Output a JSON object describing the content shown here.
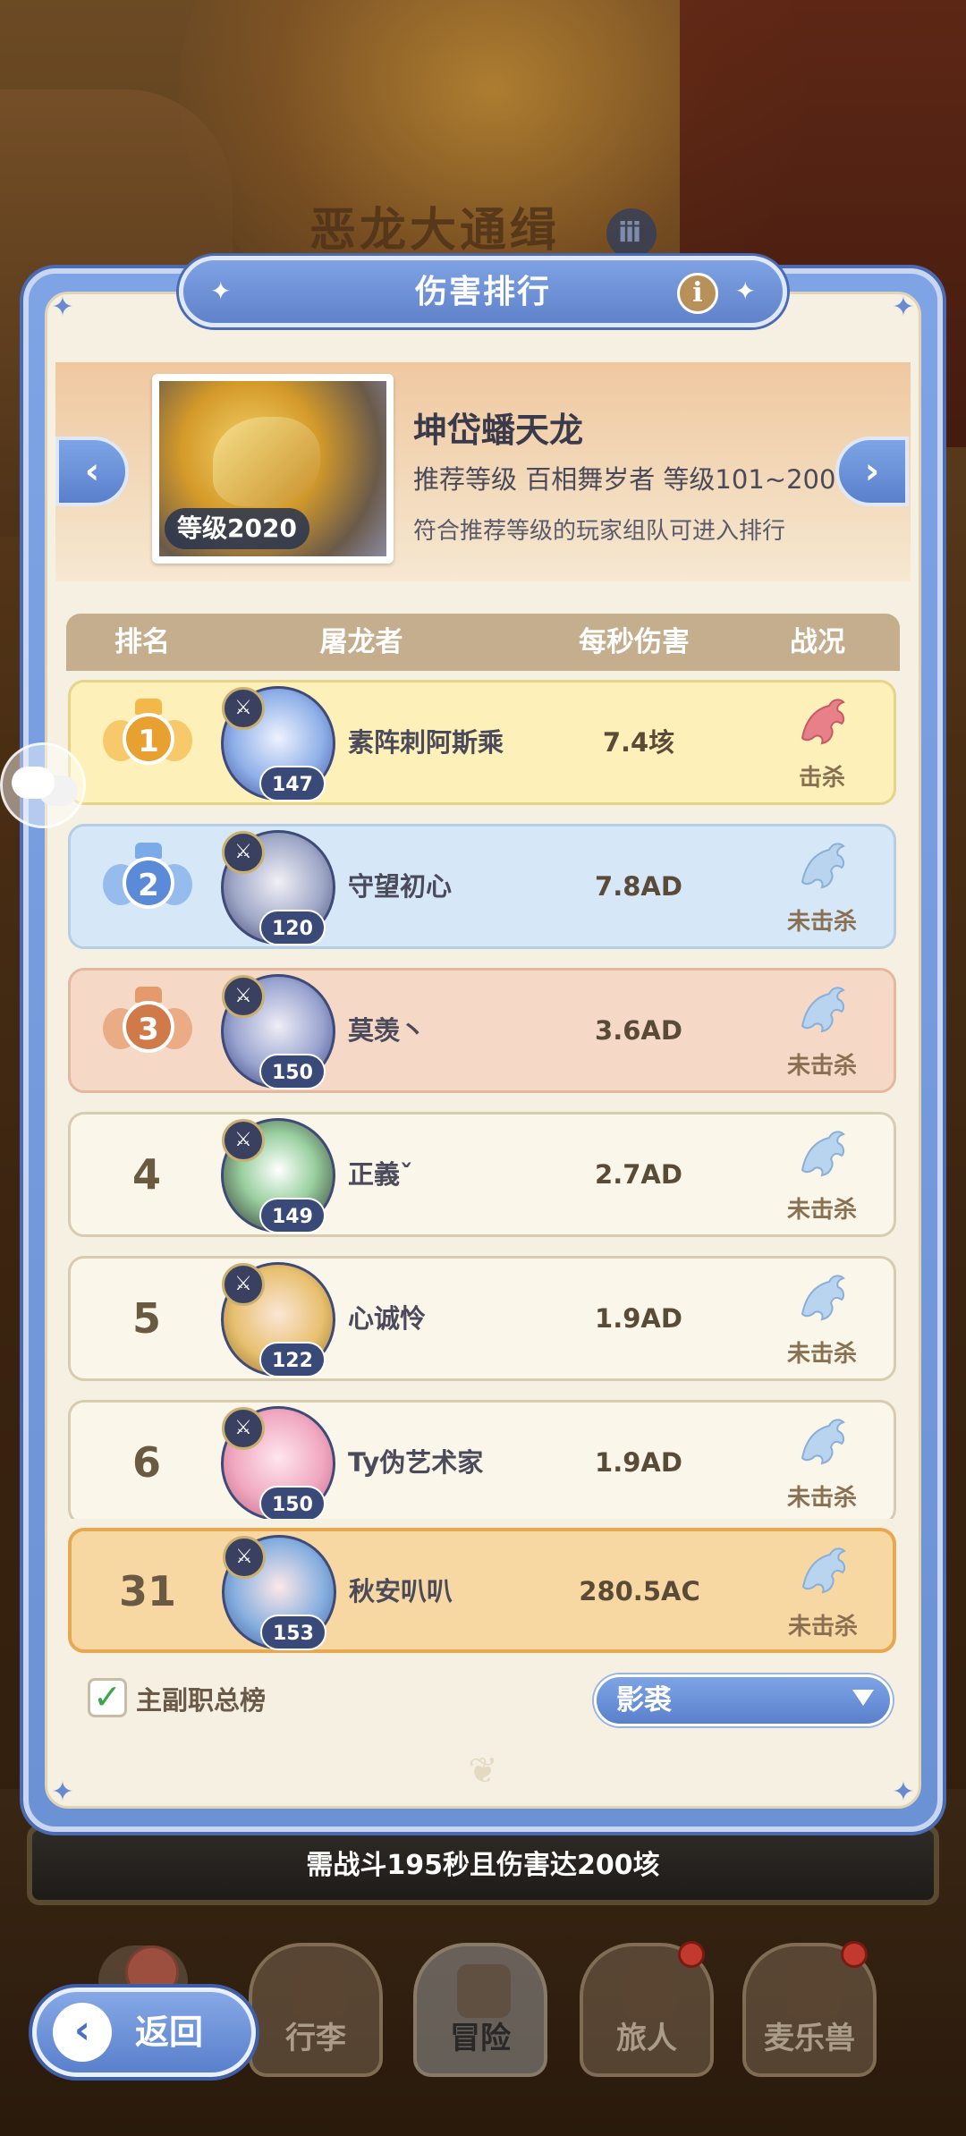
{
  "background": {
    "title": "恶龙大通缉",
    "badge": "ⅲ"
  },
  "panel": {
    "title": "伤害排行",
    "info_icon": "info-icon",
    "info_glyph": "i"
  },
  "boss": {
    "name": "坤岱蟠天龙",
    "level_badge": "等级2020",
    "recommend": "推荐等级 百相舞岁者 等级101~200",
    "note": "符合推荐等级的玩家组队可进入排行",
    "prev_glyph": "‹",
    "next_glyph": "›"
  },
  "table": {
    "headers": [
      "排名",
      "屠龙者",
      "每秒伤害",
      "战况"
    ],
    "rows": [
      {
        "rank": "1",
        "medal": "gold",
        "level": "147",
        "name": "素阵刺阿斯乘",
        "dps": "7.4垓",
        "status": "击杀",
        "killed": true
      },
      {
        "rank": "2",
        "medal": "silver",
        "level": "120",
        "name": "守望初心",
        "dps": "7.8AD",
        "status": "未击杀",
        "killed": false
      },
      {
        "rank": "3",
        "medal": "bronze",
        "level": "150",
        "name": "莫羡丶",
        "dps": "3.6AD",
        "status": "未击杀",
        "killed": false
      },
      {
        "rank": "4",
        "medal": "",
        "level": "149",
        "name": "正義ˇ",
        "dps": "2.7AD",
        "status": "未击杀",
        "killed": false
      },
      {
        "rank": "5",
        "medal": "",
        "level": "122",
        "name": "心诚怜",
        "dps": "1.9AD",
        "status": "未击杀",
        "killed": false
      },
      {
        "rank": "6",
        "medal": "",
        "level": "150",
        "name": "Ty伪艺术家",
        "dps": "1.9AD",
        "status": "未击杀",
        "killed": false
      }
    ],
    "self_row": {
      "rank": "31",
      "level": "153",
      "name": "秋安叭叭",
      "dps": "280.5AC",
      "status": "未击杀"
    }
  },
  "controls": {
    "checkbox_label": "主副职总榜",
    "checkbox_checked": true,
    "check_glyph": "✓",
    "select_value": "影裘"
  },
  "requirement": "需战斗195秒且伤害达200垓",
  "nav": {
    "back_label": "返回",
    "back_glyph": "‹",
    "items": [
      {
        "label": "行李",
        "dot": false
      },
      {
        "label": "冒险",
        "dot": false,
        "active": true
      },
      {
        "label": "旅人",
        "dot": true
      },
      {
        "label": "麦乐兽",
        "dot": true
      }
    ]
  },
  "colors": {
    "accent_blue": "#6c92d6",
    "panel_bg": "#f6f0e2",
    "gold": "#e8a030",
    "silver": "#5a8ad8",
    "bronze": "#d07a4a",
    "dragon_killed": "#e8808a",
    "dragon_alive": "#b8d4ee"
  }
}
